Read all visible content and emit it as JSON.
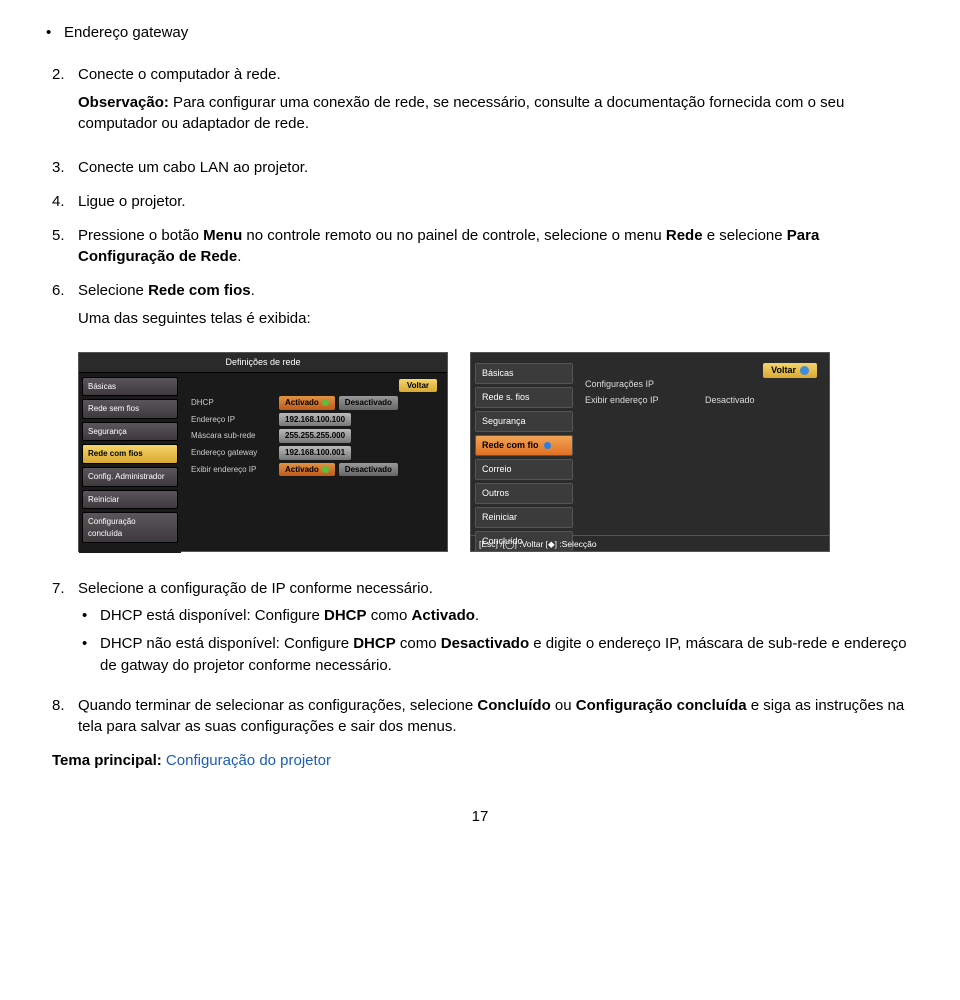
{
  "top_bullet": {
    "text": "Endereço gateway"
  },
  "steps": {
    "s2": {
      "num": "2.",
      "text": "Conecte o computador à rede.",
      "note_prefix": "Observação:",
      "note_rest": " Para configurar uma conexão de rede, se necessário, consulte a documentação fornecida com o seu computador ou adaptador de rede."
    },
    "s3": {
      "num": "3.",
      "text": "Conecte um cabo LAN ao projetor."
    },
    "s4": {
      "num": "4.",
      "text": "Ligue o projetor."
    },
    "s5": {
      "num": "5.",
      "pre": "Pressione o botão ",
      "b1": "Menu",
      "mid": " no controle remoto ou no painel de controle, selecione o menu ",
      "b2": "Rede",
      "mid2": " e selecione ",
      "b3": "Para Configuração de Rede",
      "post": "."
    },
    "s6": {
      "num": "6.",
      "pre": "Selecione ",
      "b1": "Rede com fios",
      "post": ".",
      "sub": "Uma das seguintes telas é exibida:"
    },
    "s7": {
      "num": "7.",
      "text": "Selecione a configuração de IP conforme necessário.",
      "bullet1_pre": "DHCP está disponível: Configure ",
      "bullet1_b1": "DHCP",
      "bullet1_mid": " como ",
      "bullet1_b2": "Activado",
      "bullet1_post": ".",
      "bullet2_pre": "DHCP não está disponível: Configure ",
      "bullet2_b1": "DHCP",
      "bullet2_mid": " como ",
      "bullet2_b2": "Desactivado",
      "bullet2_post": " e digite o endereço IP, máscara de sub-rede e endereço de gatway do projetor conforme necessário."
    },
    "s8": {
      "num": "8.",
      "pre": "Quando terminar de selecionar as configurações, selecione ",
      "b1": "Concluído",
      "mid": " ou ",
      "b2": "Configuração concluída",
      "post": " e siga as instruções na tela para salvar as suas configurações e sair dos menus."
    }
  },
  "tema": {
    "label": "Tema principal:",
    "link": "Configuração do projetor"
  },
  "page_number": "17",
  "screenshot1": {
    "title": "Definições de rede",
    "back": "Voltar",
    "tabs": [
      "Básicas",
      "Rede sem fios",
      "Segurança",
      "Rede com fios",
      "Config. Administrador",
      "Reiniciar",
      "Configuração concluída"
    ],
    "rows": {
      "dhcp": {
        "label": "DHCP",
        "on": "Activado",
        "off": "Desactivado"
      },
      "ip": {
        "label": "Endereço IP",
        "val": "192.168.100.100"
      },
      "mask": {
        "label": "Máscara sub-rede",
        "val": "255.255.255.000"
      },
      "gw": {
        "label": "Endereço gateway",
        "val": "192.168.100.001"
      },
      "show": {
        "label": "Exibir endereço IP",
        "on": "Activado",
        "off": "Desactivado"
      }
    }
  },
  "screenshot2": {
    "back": "Voltar",
    "tabs": [
      "Básicas",
      "Rede s. fios",
      "Segurança",
      "Rede com fio",
      "Correio",
      "Outros",
      "Reiniciar",
      "Concluído"
    ],
    "lines": {
      "conf": "Configurações IP",
      "show": "Exibir endereço IP",
      "showv": "Desactivado"
    },
    "footer": "[Esc] /[◯] :Voltar  [◆] :Selecção"
  }
}
